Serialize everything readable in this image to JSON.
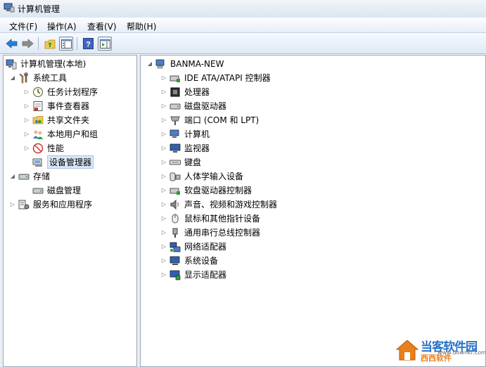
{
  "window": {
    "title": "计算机管理"
  },
  "menu": [
    "文件(F)",
    "操作(A)",
    "查看(V)",
    "帮助(H)"
  ],
  "toolbar": {
    "buttons": [
      "back-icon",
      "forward-icon",
      "up-folder-icon",
      "show-tree-icon",
      "help-icon",
      "show-action-pane-icon"
    ]
  },
  "tree": {
    "root": "计算机管理(本地)",
    "system_tools": "系统工具",
    "task_scheduler": "任务计划程序",
    "event_viewer": "事件查看器",
    "shared_folders": "共享文件夹",
    "local_users": "本地用户和组",
    "performance": "性能",
    "device_manager": "设备管理器",
    "storage": "存储",
    "disk_management": "磁盘管理",
    "services": "服务和应用程序"
  },
  "devices": {
    "computer_name": "BANMA-NEW",
    "items": [
      "IDE ATA/ATAPI 控制器",
      "处理器",
      "磁盘驱动器",
      "端口 (COM 和 LPT)",
      "计算机",
      "监视器",
      "键盘",
      "人体学输入设备",
      "软盘驱动器控制器",
      "声音、视频和游戏控制器",
      "鼠标和其他指针设备",
      "通用串行总线控制器",
      "网络适配器",
      "系统设备",
      "显示适配器"
    ]
  },
  "watermark": {
    "name": "当客软件园",
    "sub": "西西软件",
    "url": "www.downkr.com"
  }
}
